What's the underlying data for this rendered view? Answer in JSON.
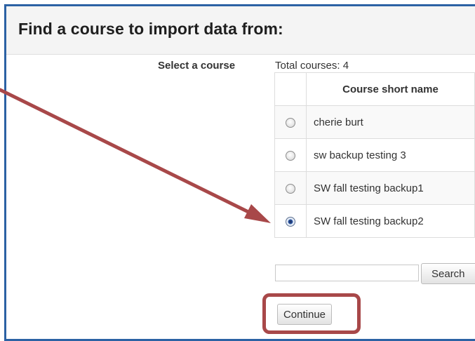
{
  "dialog": {
    "title": "Find a course to import data from:",
    "select_label": "Select a course",
    "total_courses": "Total courses: 4"
  },
  "table": {
    "header": "Course short name",
    "rows": [
      {
        "name": "cherie burt",
        "selected": false
      },
      {
        "name": "sw backup testing 3",
        "selected": false
      },
      {
        "name": "SW fall testing backup1",
        "selected": false
      },
      {
        "name": "SW fall testing backup2",
        "selected": true
      }
    ]
  },
  "search": {
    "value": "",
    "button_label": "Search"
  },
  "continue_label": "Continue",
  "colors": {
    "frame_border": "#2c62a4",
    "annotation": "#a84849",
    "header_bg": "#f4f4f4"
  }
}
